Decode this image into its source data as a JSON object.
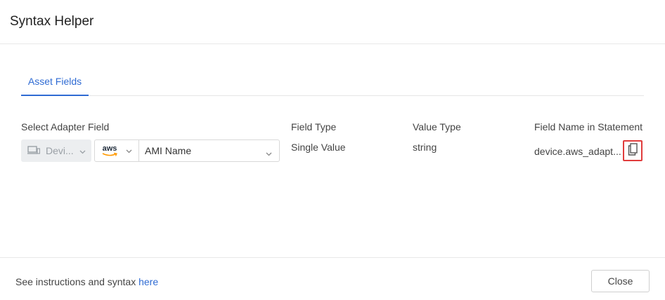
{
  "dialog": {
    "title": "Syntax Helper"
  },
  "tabs": [
    {
      "label": "Asset Fields",
      "active": true
    }
  ],
  "columns": {
    "select_adapter_field": "Select Adapter Field",
    "field_type": "Field Type",
    "value_type": "Value Type",
    "field_name_in_statement": "Field Name in Statement"
  },
  "row": {
    "entity_select": {
      "icon": "devices-icon",
      "value": "Devi..."
    },
    "adapter_select": {
      "icon": "aws-logo-icon",
      "value": "aws"
    },
    "field_select": {
      "value": "AMI Name"
    },
    "field_type": "Single Value",
    "value_type": "string",
    "field_name": "device.aws_adapt...",
    "copy_icon": "copy-icon"
  },
  "footer": {
    "text": "See instructions and syntax ",
    "link": "here",
    "close_label": "Close"
  },
  "colors": {
    "accent": "#2f6bd3",
    "highlight_border": "#e03c3c"
  }
}
